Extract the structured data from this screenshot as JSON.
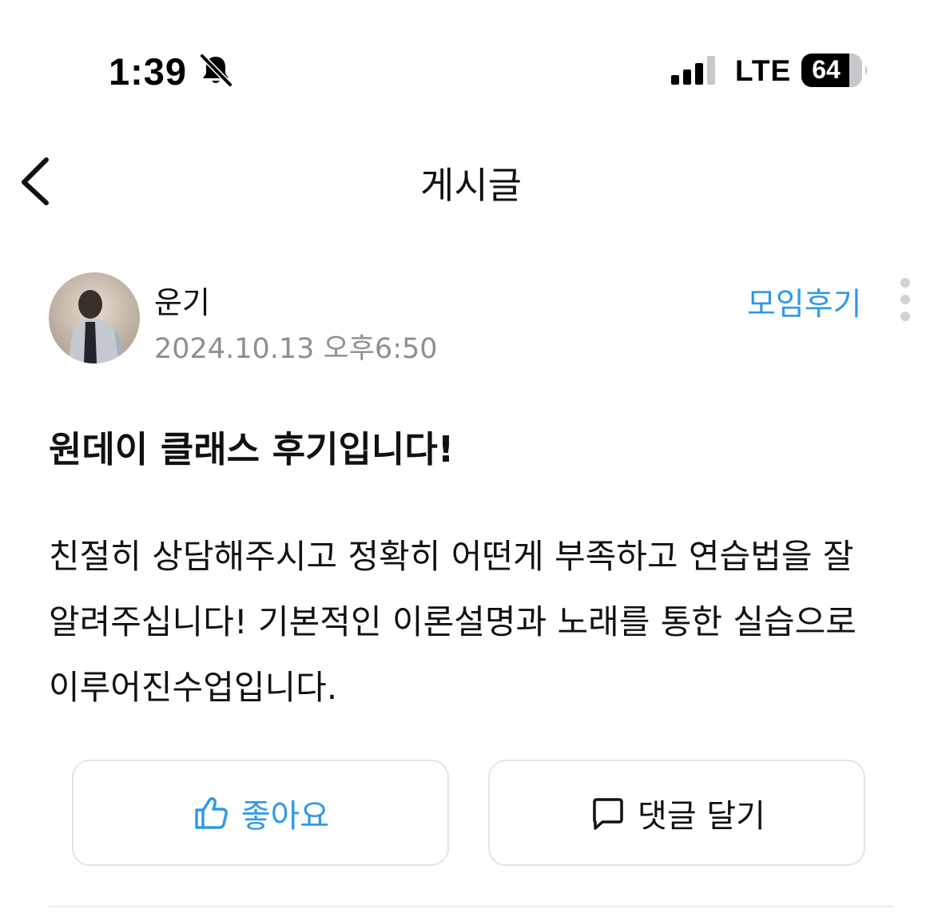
{
  "status_bar": {
    "time": "1:39",
    "network": "LTE",
    "battery": "64"
  },
  "nav": {
    "title": "게시글"
  },
  "post": {
    "author": "운기",
    "date": "2024.10.13 오후6:50",
    "category": "모임후기",
    "title": "원데이 클래스 후기입니다!",
    "body": "친절히 상담해주시고 정확히 어떤게 부족하고 연습법을 잘 알려주십니다! 기본적인 이론설명과 노래를 통한 실습으로 이루어진수업입니다."
  },
  "actions": {
    "like_label": "좋아요",
    "comment_label": "댓글 달기"
  },
  "colors": {
    "accent": "#2e9ae6",
    "meta_text": "#8e8e93",
    "button_border": "#e4e4e6"
  },
  "icons": [
    "bell-slash-icon",
    "signal-icon",
    "battery-icon",
    "chevron-left-icon",
    "more-vertical-icon",
    "thumbs-up-icon",
    "comment-icon"
  ]
}
